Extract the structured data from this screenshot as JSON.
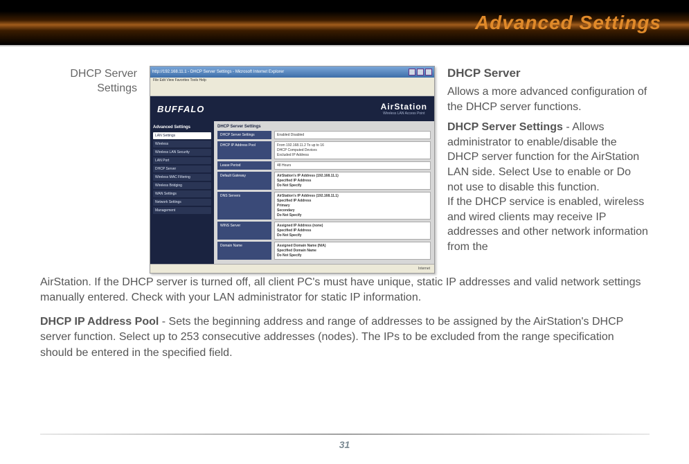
{
  "header": {
    "title": "Advanced Settings"
  },
  "leftLabel": "DHCP Server Settings",
  "screenshot": {
    "windowTitle": "http://192.168.11.1 - DHCP Server Settings - Microsoft Internet Explorer",
    "menu": "File  Edit  View  Favorites  Tools  Help",
    "brandLeft": "BUFFALO",
    "brandRight1": "AirStation",
    "brandRight2": "Wireless LAN Access Point",
    "navHead": "Advanced Settings",
    "nav": [
      "LAN Settings",
      "Wireless",
      "Wireless LAN Security",
      "LAN Port",
      "DHCP Server",
      "Wireless MAC Filtering",
      "Wireless Bridging",
      "WAN Settings",
      "Network Settings",
      "Management"
    ],
    "navSelected": 0,
    "sectionTitle": "DHCP Server Settings",
    "rows": [
      {
        "label": "DHCP Server Settings",
        "lines": [
          "Enabled   Disabled"
        ]
      },
      {
        "label": "DHCP IP Address Pool",
        "lines": [
          "From 192.168.11.2   To up to 16",
          "DHCP Computed Devices",
          "Excluded IP Address"
        ]
      },
      {
        "label": "Lease Period",
        "lines": [
          "48   Hours"
        ]
      },
      {
        "label": "Default Gateway",
        "lines": [
          "AirStation's IP Address (192.168.11.1)",
          "Specified IP Address",
          "Do Not Specify"
        ]
      },
      {
        "label": "DNS Servers",
        "lines": [
          "AirStation's IP Address (192.168.11.1)",
          "Specified IP Address",
          "Primary",
          "Secondary",
          "Do Not Specify"
        ]
      },
      {
        "label": "WINS Server",
        "lines": [
          "Assigned IP Address (none)",
          "Specified IP Address",
          "Do Not Specify"
        ]
      },
      {
        "label": "Domain Name",
        "lines": [
          "Assigned Domain Name (N/A)",
          "Specified Domain Name",
          "Do Not Specify"
        ]
      }
    ],
    "status": "Internet"
  },
  "right": {
    "heading": "DHCP Server",
    "intro": "Allows a more advanced configuration of the DHCP server functions.",
    "sub": "DHCP Server Settings",
    "subText": " - Allows administrator to enable/disable the DHCP server function for the AirStation LAN side. Select Use to enable or Do not use to disable this function.",
    "cont": "If the DHCP service is enabled, wireless and wired clients may receive IP addresses and other network information from the"
  },
  "para1": "AirStation.  If the DHCP server is turned off, all client PC's must have unique, static IP addresses and valid network settings manually entered. Check with your LAN administrator for static IP information.",
  "para2label": "DHCP IP Address Pool",
  "para2": " - Sets the beginning address and range of addresses to be assigned by the AirStation's DHCP server function.  Select up to 253 consecutive addresses (nodes).  The IPs to be excluded from the range specification should be entered in the specified field.",
  "pageNumber": "31"
}
